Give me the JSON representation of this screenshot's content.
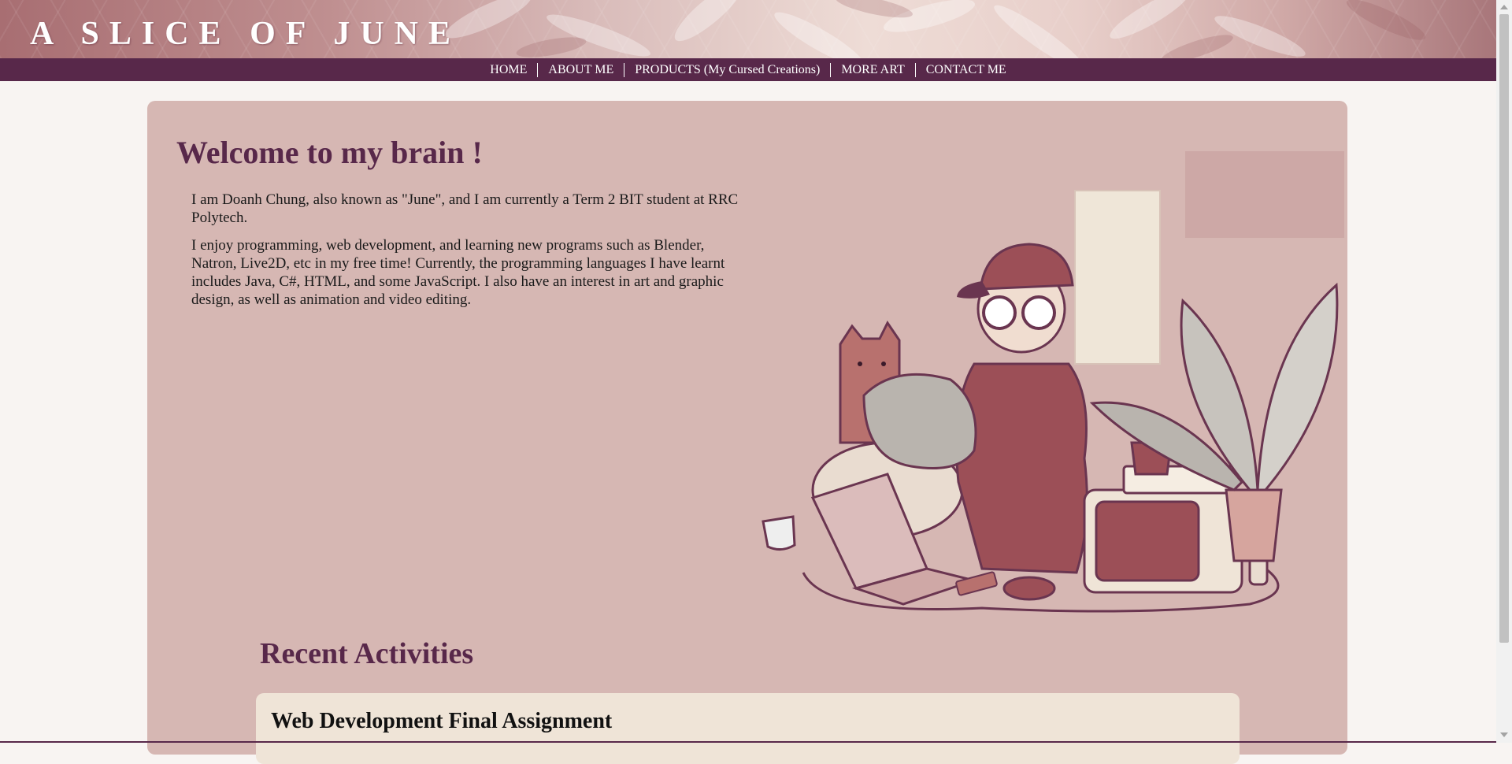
{
  "site": {
    "title": "A SLICE OF JUNE"
  },
  "nav": {
    "items": [
      {
        "label": "HOME"
      },
      {
        "label": "ABOUT ME"
      },
      {
        "label": "PRODUCTS (My Cursed Creations)"
      },
      {
        "label": "MORE ART"
      },
      {
        "label": "CONTACT ME"
      }
    ]
  },
  "main": {
    "heading": "Welcome to my brain !",
    "paragraphs": [
      "I am Doanh Chung, also known as \"June\", and I am currently a Term 2 BIT student at RRC Polytech.",
      "I enjoy programming, web development, and learning new programs such as Blender, Natron, Live2D, etc in my free time! Currently, the programming languages I have learnt includes Java, C#, HTML, and some JavaScript. I also have an interest in art and graphic design, as well as animation and video editing."
    ],
    "illustration_icon": "artist-with-cat-and-plants-illustration"
  },
  "recent": {
    "heading": "Recent Activities",
    "items": [
      {
        "title": "Web Development Final Assignment"
      }
    ]
  },
  "colors": {
    "nav_bg": "#58284a",
    "card_bg": "#d6b7b3",
    "heading": "#58284a",
    "activity_bg": "#efe4d7",
    "page_bg": "#f8f4f2"
  }
}
